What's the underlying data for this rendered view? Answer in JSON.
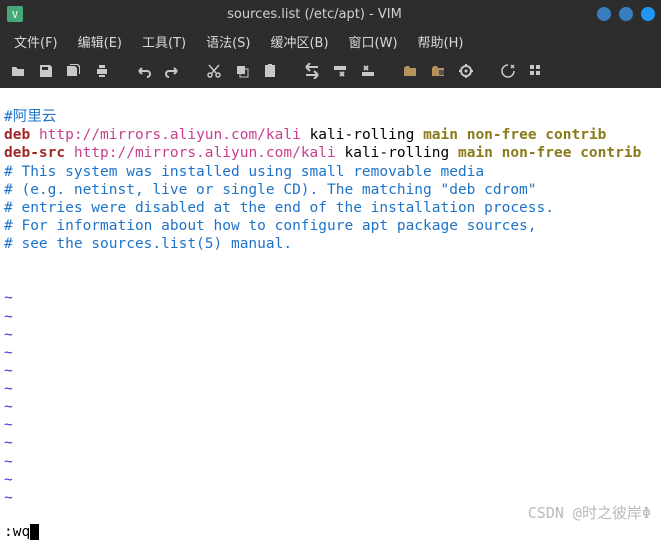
{
  "window": {
    "title": "sources.list (/etc/apt) - VIM"
  },
  "menubar": {
    "file": "文件(F)",
    "edit": "编辑(E)",
    "tools": "工具(T)",
    "syntax": "语法(S)",
    "buffers": "缓冲区(B)",
    "window": "窗口(W)",
    "help": "帮助(H)"
  },
  "editor": {
    "line1_comment": "#阿里云",
    "line2_deb": "deb",
    "line2_url": "http://mirrors.aliyun.com/kali",
    "line2_rest": "kali-rolling",
    "line2_main": "main non-free contrib",
    "line3_deb": "deb-src",
    "line3_url": "http://mirrors.aliyun.com/kali",
    "line3_rest": "kali-rolling",
    "line3_main": "main non-free contrib",
    "line4": "# This system was installed using small removable media",
    "line5": "# (e.g. netinst, live or single CD). The matching \"deb cdrom\"",
    "line6": "# entries were disabled at the end of the installation process.",
    "line7": "# For information about how to configure apt package sources,",
    "line8": "# see the sources.list(5) manual.",
    "tilde": "~"
  },
  "command": ":wq",
  "watermark": "CSDN @时之彼岸Φ"
}
